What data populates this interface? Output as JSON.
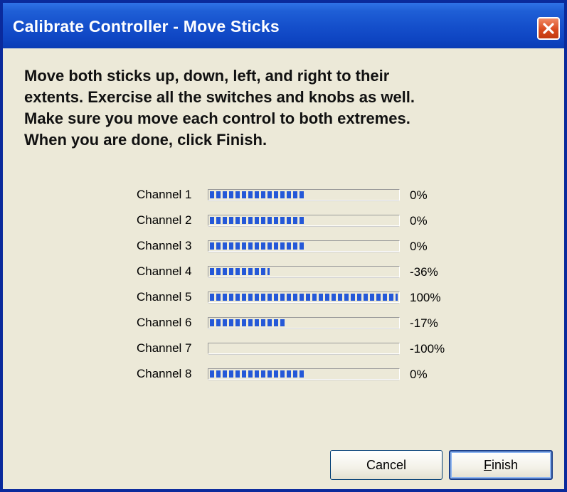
{
  "window": {
    "title": "Calibrate Controller - Move Sticks",
    "close_icon": "close-icon"
  },
  "instructions": {
    "lines": [
      "Move both sticks up, down, left, and right to their",
      "extents.  Exercise all the switches and knobs as well.",
      "Make sure you move each control to both extremes.",
      "When you are done, click Finish."
    ]
  },
  "channels": [
    {
      "label": "Channel 1",
      "value": "0%",
      "fill_fraction": 0.5
    },
    {
      "label": "Channel 2",
      "value": "0%",
      "fill_fraction": 0.5
    },
    {
      "label": "Channel 3",
      "value": "0%",
      "fill_fraction": 0.5
    },
    {
      "label": "Channel 4",
      "value": "-36%",
      "fill_fraction": 0.32
    },
    {
      "label": "Channel 5",
      "value": "100%",
      "fill_fraction": 1.0
    },
    {
      "label": "Channel 6",
      "value": "-17%",
      "fill_fraction": 0.41
    },
    {
      "label": "Channel 7",
      "value": "-100%",
      "fill_fraction": 0.0
    },
    {
      "label": "Channel 8",
      "value": "0%",
      "fill_fraction": 0.5
    }
  ],
  "buttons": {
    "cancel_label": "Cancel",
    "finish_mnemonic": "F",
    "finish_rest": "inish"
  },
  "colors": {
    "titlebar": "#0a3cb5",
    "progress_fill": "#2458d8",
    "close_button": "#d94a1f",
    "dialog_face": "#ece9d8"
  }
}
